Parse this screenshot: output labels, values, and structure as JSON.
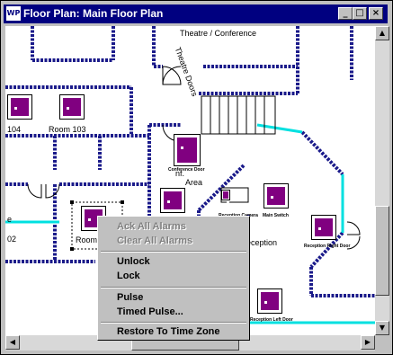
{
  "window": {
    "title": "Floor Plan: Main Floor Plan",
    "app_icon": "WP",
    "controls": {
      "minimize": "_",
      "maximize": "□",
      "close": "×"
    }
  },
  "floorplan": {
    "labels": {
      "theatre": "Theatre / Conference",
      "theatre_doors": "Theatre Doors",
      "room104": "104",
      "room103": "Room 103",
      "conference_door": "Conference Door",
      "conf_area_1": "nf.",
      "conf_area_2": "Area",
      "reception": "eception",
      "reader_a": "Reception Camera",
      "reader_b": "Main Switch",
      "reader_c": "Reception Right Door",
      "reader_d": "Reception Left Door",
      "room_left_1": "e",
      "room_left_2": "02",
      "room_partial": "Room"
    }
  },
  "context_menu": {
    "items": [
      {
        "label": "Ack All Alarms",
        "enabled": false
      },
      {
        "label": "Clear All Alarms",
        "enabled": false
      },
      {
        "label": "Unlock",
        "enabled": true
      },
      {
        "label": "Lock",
        "enabled": true
      },
      {
        "label": "Pulse",
        "enabled": true
      },
      {
        "label": "Timed Pulse...",
        "enabled": true
      },
      {
        "label": "Restore To Time Zone",
        "enabled": true
      }
    ]
  },
  "colors": {
    "wall": "#1a1a8a",
    "reader": "#800080",
    "glass": "#00e0e0",
    "titlebar": "#000080"
  }
}
